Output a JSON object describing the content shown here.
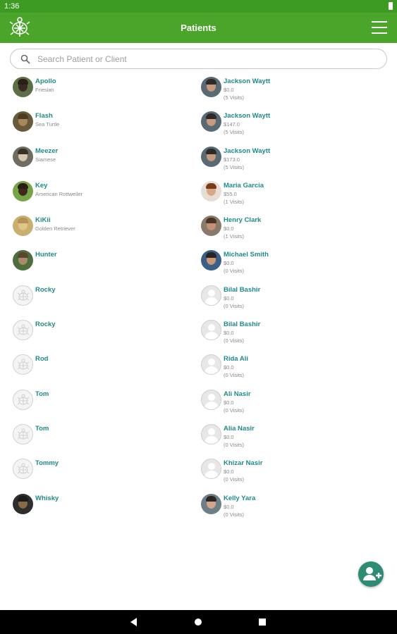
{
  "status_bar": {
    "time": "1:36"
  },
  "app_bar": {
    "title": "Patients",
    "logo_icon": "turtle-logo-icon",
    "menu_icon": "hamburger-menu-icon"
  },
  "search": {
    "placeholder": "Search Patient or Client",
    "value": ""
  },
  "patients": [
    {
      "name": "Apollo",
      "breed": "Friesian",
      "avatar": "photo-horse"
    },
    {
      "name": "Flash",
      "breed": "Sea Turtle",
      "avatar": "photo-turtle"
    },
    {
      "name": "Meezer",
      "breed": "Siamese",
      "avatar": "photo-cat"
    },
    {
      "name": "Key",
      "breed": "American Rottweiler",
      "avatar": "photo-dog"
    },
    {
      "name": "KiKii",
      "breed": "Golden Retriever",
      "avatar": "photo-golden"
    },
    {
      "name": "Hunter",
      "breed": "",
      "avatar": "photo-hunter"
    },
    {
      "name": "Rocky",
      "breed": "",
      "avatar": "placeholder"
    },
    {
      "name": "Rocky",
      "breed": "",
      "avatar": "placeholder"
    },
    {
      "name": "Rod",
      "breed": "",
      "avatar": "placeholder"
    },
    {
      "name": "Tom",
      "breed": "",
      "avatar": "placeholder"
    },
    {
      "name": "Tom",
      "breed": "",
      "avatar": "placeholder"
    },
    {
      "name": "Tommy",
      "breed": "",
      "avatar": "placeholder"
    },
    {
      "name": "Whisky",
      "breed": "",
      "avatar": "photo-whisky"
    }
  ],
  "clients": [
    {
      "name": "Jackson Waytt",
      "amount": "$0.0",
      "visits": "(5 Visits)",
      "avatar": "photo-man"
    },
    {
      "name": "Jackson Waytt",
      "amount": "$147.0",
      "visits": "(5 Visits)",
      "avatar": "photo-man"
    },
    {
      "name": "Jackson Waytt",
      "amount": "$173.0",
      "visits": "(5 Visits)",
      "avatar": "photo-man"
    },
    {
      "name": "Maria Garcia",
      "amount": "$55.0",
      "visits": "(1 Visits)",
      "avatar": "photo-woman"
    },
    {
      "name": "Henry Clark",
      "amount": "$0.0",
      "visits": "(1 Visits)",
      "avatar": "photo-henry"
    },
    {
      "name": "Michael Smith",
      "amount": "$0.0",
      "visits": "(0 Visits)",
      "avatar": "photo-michael"
    },
    {
      "name": "Bilal Bashir",
      "amount": "$0.0",
      "visits": "(0 Visits)",
      "avatar": "placeholder-person"
    },
    {
      "name": "Bilal Bashir",
      "amount": "$0.0",
      "visits": "(0 Visits)",
      "avatar": "placeholder-person"
    },
    {
      "name": "Rida Ali",
      "amount": "$0.0",
      "visits": "(0 Visits)",
      "avatar": "placeholder-person"
    },
    {
      "name": "Ali Nasir",
      "amount": "$0.0",
      "visits": "(0 Visits)",
      "avatar": "placeholder-person"
    },
    {
      "name": "Alia Nasir",
      "amount": "$0.0",
      "visits": "(0 Visits)",
      "avatar": "placeholder-person"
    },
    {
      "name": "Khizar  Nasir",
      "amount": "$0.0",
      "visits": "(0 Visits)",
      "avatar": "placeholder-person"
    },
    {
      "name": "Kelly Yara",
      "amount": "$0.0",
      "visits": "(0 Visits)",
      "avatar": "photo-kelly"
    }
  ],
  "fab": {
    "icon": "add-person-icon"
  },
  "nav_bar": {
    "back_icon": "back-icon",
    "home_icon": "home-icon",
    "recents_icon": "recents-icon"
  },
  "colors": {
    "app_bar": "#4aa52a",
    "status_bar": "#3d9a23",
    "name_text": "#1f8a8a",
    "fab": "#2f8c74"
  }
}
